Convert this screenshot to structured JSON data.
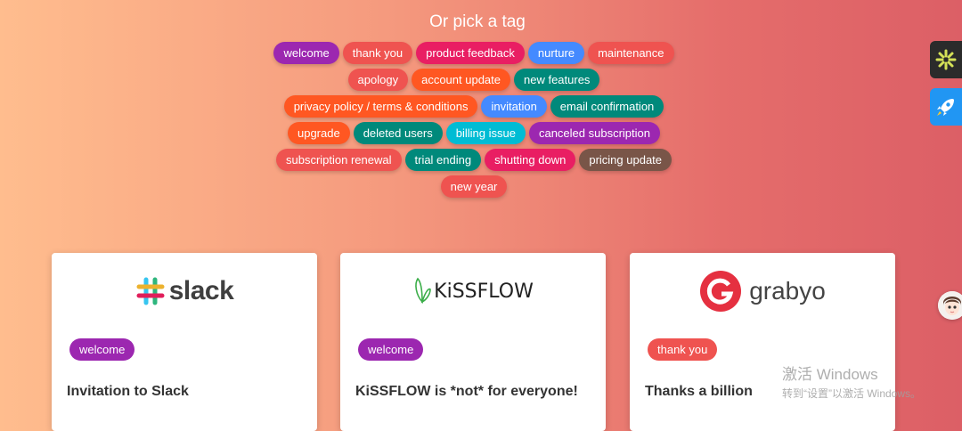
{
  "heading": "Or pick a tag",
  "tags": [
    {
      "label": "welcome",
      "color": "#9c27b0"
    },
    {
      "label": "thank you",
      "color": "#ef5350"
    },
    {
      "label": "product feedback",
      "color": "#e91e63"
    },
    {
      "label": "nurture",
      "color": "#448aff"
    },
    {
      "label": "maintenance",
      "color": "#ef5350"
    },
    {
      "break": true
    },
    {
      "label": "apology",
      "color": "#ef5350"
    },
    {
      "label": "account update",
      "color": "#ff5722"
    },
    {
      "label": "new features",
      "color": "#00897b"
    },
    {
      "break": true
    },
    {
      "label": "privacy policy / terms & conditions",
      "color": "#ff5722"
    },
    {
      "label": "invitation",
      "color": "#448aff"
    },
    {
      "label": "email confirmation",
      "color": "#00897b"
    },
    {
      "break": true
    },
    {
      "label": "upgrade",
      "color": "#ff5722"
    },
    {
      "label": "deleted users",
      "color": "#00897b"
    },
    {
      "label": "billing issue",
      "color": "#00bcd4"
    },
    {
      "label": "canceled subscription",
      "color": "#9c27b0"
    },
    {
      "break": true
    },
    {
      "label": "subscription renewal",
      "color": "#ef5350"
    },
    {
      "label": "trial ending",
      "color": "#00897b"
    },
    {
      "label": "shutting down",
      "color": "#e91e63"
    },
    {
      "label": "pricing update",
      "color": "#795548"
    },
    {
      "break": true
    },
    {
      "label": "new year",
      "color": "#ef5350"
    }
  ],
  "cards": [
    {
      "brand": "slack",
      "badge": "welcome",
      "badge_color": "#9c27b0",
      "title": "Invitation to Slack"
    },
    {
      "brand": "KiSSFLOW",
      "badge": "welcome",
      "badge_color": "#9c27b0",
      "title": "KiSSFLOW is *not* for everyone!"
    },
    {
      "brand": "grabyo",
      "badge": "thank you",
      "badge_color": "#ef5350",
      "title": "Thanks a billion"
    }
  ],
  "side_buttons": [
    {
      "icon": "pinwheel-icon",
      "color": "#2b2b2b"
    },
    {
      "icon": "rocket-icon",
      "color": "#2196f3"
    }
  ],
  "watermark": {
    "line1": "激活 Windows",
    "line2": "转到“设置”以激活 Windows。"
  }
}
